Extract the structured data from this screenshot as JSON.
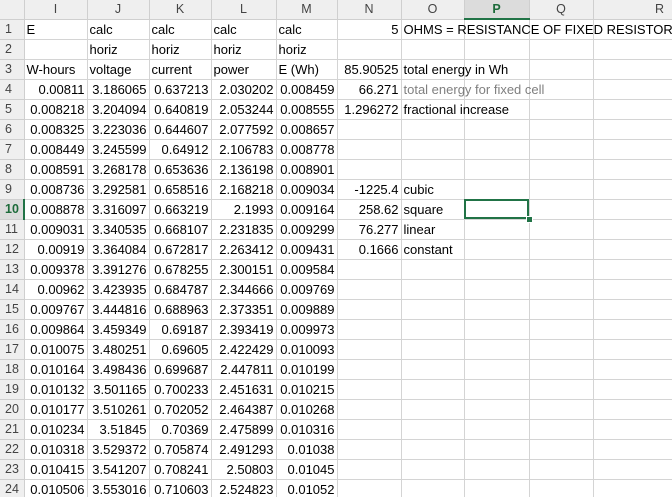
{
  "columns": [
    "I",
    "J",
    "K",
    "L",
    "M",
    "N",
    "O",
    "P",
    "Q",
    "R"
  ],
  "selected_cell": "P10",
  "rows": [
    {
      "n": "1",
      "I": "E",
      "J": "calc",
      "K": "calc",
      "L": "calc",
      "M": "calc",
      "N": "5",
      "O": "OHMS = RESISTANCE OF FIXED RESISTOR"
    },
    {
      "n": "2",
      "I": "",
      "J": "horiz",
      "K": "horiz",
      "L": "horiz",
      "M": "horiz",
      "N": "",
      "O": ""
    },
    {
      "n": "3",
      "I": "W-hours",
      "J": "voltage",
      "K": "current",
      "L": "power",
      "M": "E (Wh)",
      "N": "85.90525",
      "O": "total energy in Wh"
    },
    {
      "n": "4",
      "I": "0.00811",
      "J": "3.186065",
      "K": "0.637213",
      "L": "2.030202",
      "M": "0.008459",
      "N": "66.271",
      "O": "total energy for fixed cell"
    },
    {
      "n": "5",
      "I": "0.008218",
      "J": "3.204094",
      "K": "0.640819",
      "L": "2.053244",
      "M": "0.008555",
      "N": "1.296272",
      "O": "fractional increase"
    },
    {
      "n": "6",
      "I": "0.008325",
      "J": "3.223036",
      "K": "0.644607",
      "L": "2.077592",
      "M": "0.008657",
      "N": "",
      "O": ""
    },
    {
      "n": "7",
      "I": "0.008449",
      "J": "3.245599",
      "K": "0.64912",
      "L": "2.106783",
      "M": "0.008778",
      "N": "",
      "O": ""
    },
    {
      "n": "8",
      "I": "0.008591",
      "J": "3.268178",
      "K": "0.653636",
      "L": "2.136198",
      "M": "0.008901",
      "N": "",
      "O": ""
    },
    {
      "n": "9",
      "I": "0.008736",
      "J": "3.292581",
      "K": "0.658516",
      "L": "2.168218",
      "M": "0.009034",
      "N": "-1225.4",
      "O": "cubic"
    },
    {
      "n": "10",
      "I": "0.008878",
      "J": "3.316097",
      "K": "0.663219",
      "L": "2.1993",
      "M": "0.009164",
      "N": "258.62",
      "O": "square"
    },
    {
      "n": "11",
      "I": "0.009031",
      "J": "3.340535",
      "K": "0.668107",
      "L": "2.231835",
      "M": "0.009299",
      "N": "76.277",
      "O": "linear"
    },
    {
      "n": "12",
      "I": "0.00919",
      "J": "3.364084",
      "K": "0.672817",
      "L": "2.263412",
      "M": "0.009431",
      "N": "0.1666",
      "O": "constant"
    },
    {
      "n": "13",
      "I": "0.009378",
      "J": "3.391276",
      "K": "0.678255",
      "L": "2.300151",
      "M": "0.009584",
      "N": "",
      "O": ""
    },
    {
      "n": "14",
      "I": "0.00962",
      "J": "3.423935",
      "K": "0.684787",
      "L": "2.344666",
      "M": "0.009769",
      "N": "",
      "O": ""
    },
    {
      "n": "15",
      "I": "0.009767",
      "J": "3.444816",
      "K": "0.688963",
      "L": "2.373351",
      "M": "0.009889",
      "N": "",
      "O": ""
    },
    {
      "n": "16",
      "I": "0.009864",
      "J": "3.459349",
      "K": "0.69187",
      "L": "2.393419",
      "M": "0.009973",
      "N": "",
      "O": ""
    },
    {
      "n": "17",
      "I": "0.010075",
      "J": "3.480251",
      "K": "0.69605",
      "L": "2.422429",
      "M": "0.010093",
      "N": "",
      "O": ""
    },
    {
      "n": "18",
      "I": "0.010164",
      "J": "3.498436",
      "K": "0.699687",
      "L": "2.447811",
      "M": "0.010199",
      "N": "",
      "O": ""
    },
    {
      "n": "19",
      "I": "0.010132",
      "J": "3.501165",
      "K": "0.700233",
      "L": "2.451631",
      "M": "0.010215",
      "N": "",
      "O": ""
    },
    {
      "n": "20",
      "I": "0.010177",
      "J": "3.510261",
      "K": "0.702052",
      "L": "2.464387",
      "M": "0.010268",
      "N": "",
      "O": ""
    },
    {
      "n": "21",
      "I": "0.010234",
      "J": "3.51845",
      "K": "0.70369",
      "L": "2.475899",
      "M": "0.010316",
      "N": "",
      "O": ""
    },
    {
      "n": "22",
      "I": "0.010318",
      "J": "3.529372",
      "K": "0.705874",
      "L": "2.491293",
      "M": "0.01038",
      "N": "",
      "O": ""
    },
    {
      "n": "23",
      "I": "0.010415",
      "J": "3.541207",
      "K": "0.708241",
      "L": "2.50803",
      "M": "0.01045",
      "N": "",
      "O": ""
    },
    {
      "n": "24",
      "I": "0.010506",
      "J": "3.553016",
      "K": "0.710603",
      "L": "2.524823",
      "M": "0.01052",
      "N": "",
      "O": ""
    }
  ],
  "colors": {
    "accent": "#217346",
    "header_bg": "#efefef",
    "header_selected_bg": "#dcdcdc",
    "grid": "#d4d4d4",
    "gray_text": "#7f7f7f"
  }
}
